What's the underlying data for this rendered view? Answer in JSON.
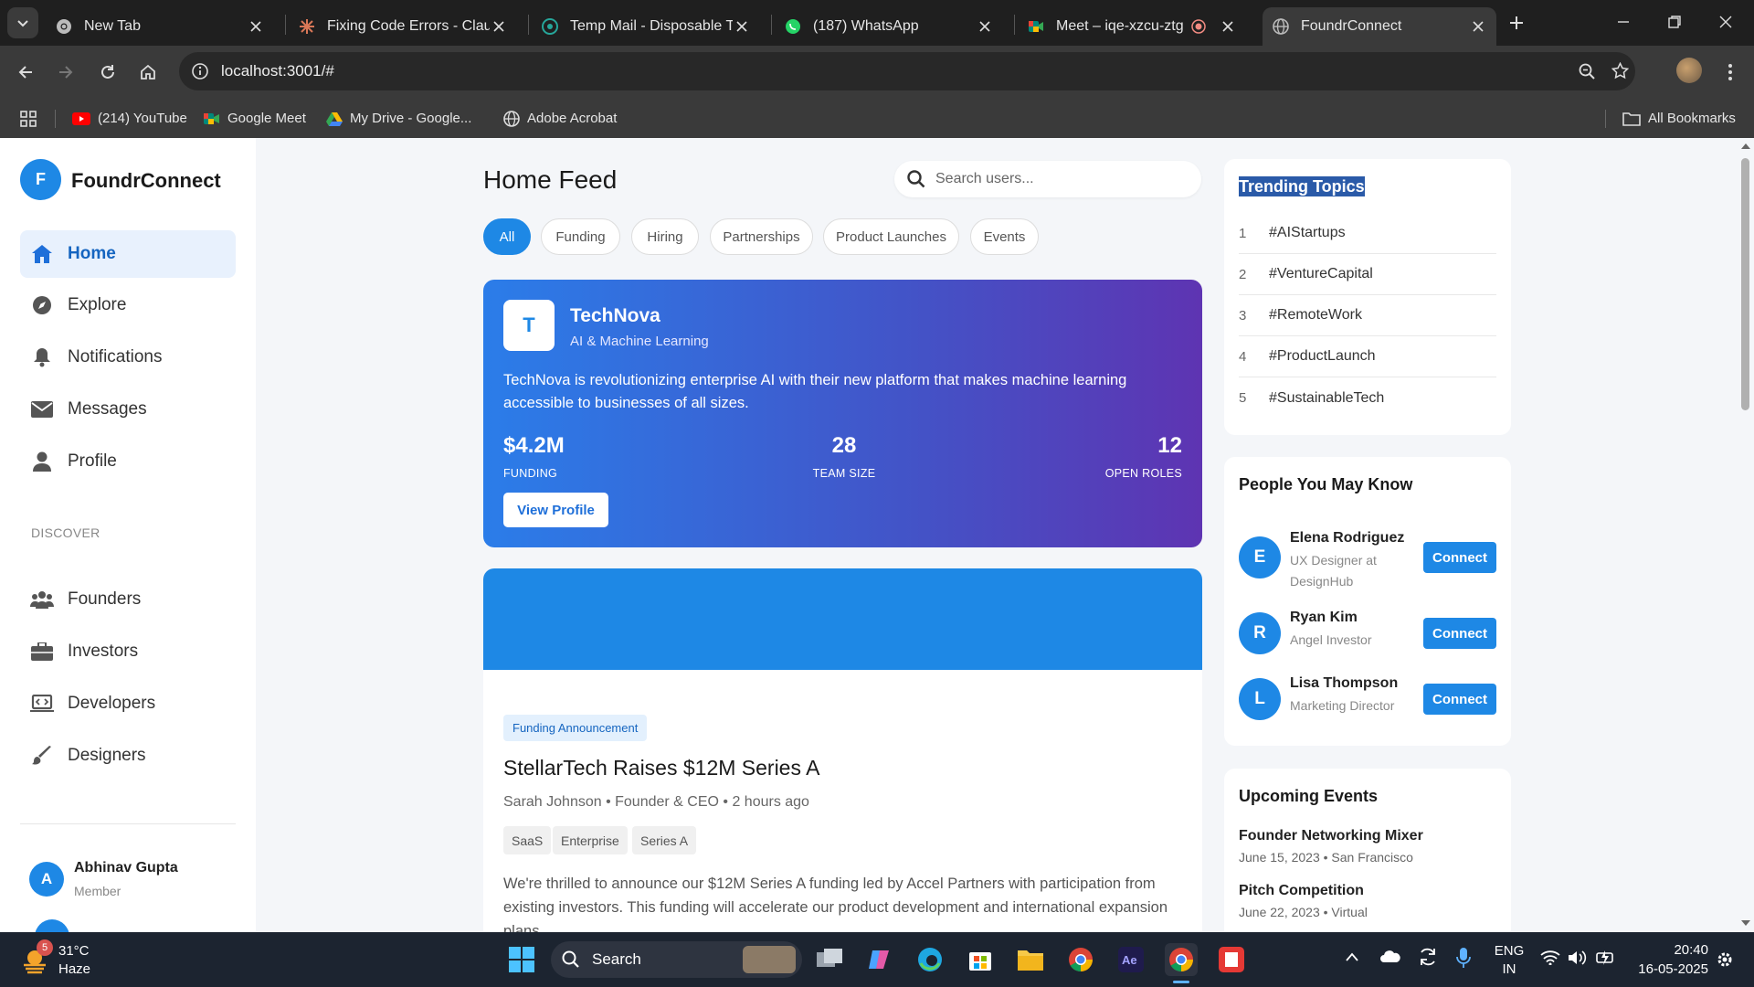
{
  "browser": {
    "tabs": [
      {
        "title": "New Tab",
        "icon": "chrome-icon"
      },
      {
        "title": "Fixing Code Errors - Claude",
        "icon": "claude-icon"
      },
      {
        "title": "Temp Mail - Disposable Temporary Email",
        "icon": "tempmail-icon"
      },
      {
        "title": "(187) WhatsApp",
        "icon": "whatsapp-icon"
      },
      {
        "title": "Meet – iqe-xzcu-ztg",
        "icon": "meet-icon"
      },
      {
        "title": "FoundrConnect",
        "icon": "globe-icon"
      }
    ],
    "active_tab": 5,
    "url": "localhost:3001/#",
    "bookmarks": [
      {
        "label": "(214) YouTube",
        "icon": "youtube-icon"
      },
      {
        "label": "Google Meet",
        "icon": "meet-icon"
      },
      {
        "label": "My Drive - Google...",
        "icon": "drive-icon"
      },
      {
        "label": "Adobe Acrobat",
        "icon": "acrobat-icon"
      }
    ],
    "all_bookmarks": "All Bookmarks"
  },
  "app": {
    "logo_letter": "F",
    "name": "FoundrConnect"
  },
  "sidebar": {
    "nav": [
      {
        "label": "Home",
        "icon": "home-icon",
        "active": true
      },
      {
        "label": "Explore",
        "icon": "compass-icon"
      },
      {
        "label": "Notifications",
        "icon": "bell-icon"
      },
      {
        "label": "Messages",
        "icon": "envelope-icon"
      },
      {
        "label": "Profile",
        "icon": "user-icon"
      }
    ],
    "discover_heading": "DISCOVER",
    "discover": [
      {
        "label": "Founders",
        "icon": "users-icon"
      },
      {
        "label": "Investors",
        "icon": "briefcase-icon"
      },
      {
        "label": "Developers",
        "icon": "laptop-code-icon"
      },
      {
        "label": "Designers",
        "icon": "paintbrush-icon"
      }
    ],
    "user": {
      "initial": "A",
      "name": "Abhinav Gupta",
      "role": "Member"
    }
  },
  "main": {
    "title": "Home Feed",
    "search_placeholder": "Search users...",
    "filters": [
      "All",
      "Funding",
      "Hiring",
      "Partnerships",
      "Product Launches",
      "Events"
    ],
    "active_filter": "All",
    "featured": {
      "logo_letter": "T",
      "name": "TechNova",
      "category": "AI & Machine Learning",
      "description": "TechNova is revolutionizing enterprise AI with their new platform that makes machine learning accessible to businesses of all sizes.",
      "stats": [
        {
          "value": "$4.2M",
          "label": "FUNDING"
        },
        {
          "value": "28",
          "label": "TEAM SIZE"
        },
        {
          "value": "12",
          "label": "OPEN ROLES"
        }
      ],
      "button": "View Profile"
    },
    "post": {
      "tag": "Funding Announcement",
      "title": "StellarTech Raises $12M Series A",
      "meta": "Sarah Johnson • Founder & CEO • 2 hours ago",
      "tags": [
        "SaaS",
        "Enterprise",
        "Series A"
      ],
      "body": "We're thrilled to announce our $12M Series A funding led by Accel Partners with participation from existing investors. This funding will accelerate our product development and international expansion plans."
    }
  },
  "right": {
    "trending": {
      "title": "Trending Topics",
      "items": [
        "#AIStartups",
        "#VentureCapital",
        "#RemoteWork",
        "#ProductLaunch",
        "#SustainableTech"
      ]
    },
    "people": {
      "title": "People You May Know",
      "items": [
        {
          "initial": "E",
          "name": "Elena Rodriguez",
          "role": "UX Designer at DesignHub",
          "button": "Connect"
        },
        {
          "initial": "R",
          "name": "Ryan Kim",
          "role": "Angel Investor",
          "button": "Connect"
        },
        {
          "initial": "L",
          "name": "Lisa Thompson",
          "role": "Marketing Director",
          "button": "Connect"
        }
      ]
    },
    "events": {
      "title": "Upcoming Events",
      "items": [
        {
          "name": "Founder Networking Mixer",
          "meta": "June 15, 2023 • San Francisco"
        },
        {
          "name": "Pitch Competition",
          "meta": "June 22, 2023 • Virtual"
        }
      ]
    }
  },
  "taskbar": {
    "weather_badge": "5",
    "temp": "31°C",
    "condition": "Haze",
    "search": "Search",
    "lang1": "ENG",
    "lang2": "IN",
    "time": "20:40",
    "date": "16-05-2025"
  },
  "colors": {
    "accent": "#1e88e5",
    "gradient_start": "#2b7de9",
    "gradient_end": "#5e34b2"
  }
}
